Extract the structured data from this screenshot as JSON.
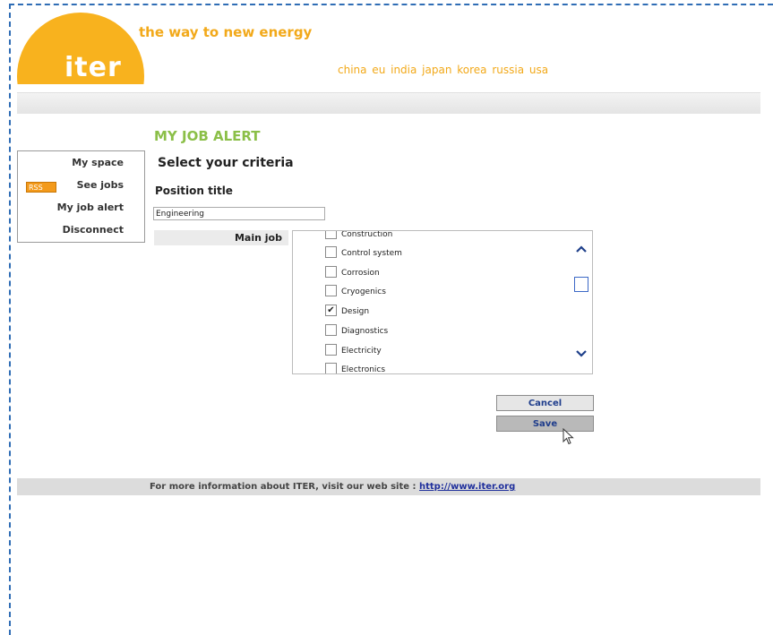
{
  "header": {
    "logo_text": "iter",
    "tagline": "the way to new energy",
    "countries": "china eu india japan korea russia usa"
  },
  "sidebar": {
    "items": [
      {
        "label": "My space"
      },
      {
        "label": "See jobs",
        "badge": "RSS"
      },
      {
        "label": "My job alert"
      },
      {
        "label": "Disconnect"
      }
    ]
  },
  "main": {
    "title": "MY JOB ALERT",
    "subtitle": "Select your criteria",
    "position_title_label": "Position title",
    "position_title_value": "Engineering",
    "main_job_label": "Main job",
    "options": [
      {
        "label": "Construction",
        "checked": false
      },
      {
        "label": "Control system",
        "checked": false
      },
      {
        "label": "Corrosion",
        "checked": false
      },
      {
        "label": "Cryogenics",
        "checked": false
      },
      {
        "label": "Design",
        "checked": true
      },
      {
        "label": "Diagnostics",
        "checked": false
      },
      {
        "label": "Electricity",
        "checked": false
      },
      {
        "label": "Electronics",
        "checked": false
      }
    ]
  },
  "buttons": {
    "cancel": "Cancel",
    "save": "Save"
  },
  "footer": {
    "text": "For more information about ITER, visit our web site : ",
    "link": "http://www.iter.org"
  },
  "colors": {
    "accent_orange": "#f8b21e",
    "title_green": "#8bbf48",
    "frame_blue": "#2f6db5"
  }
}
